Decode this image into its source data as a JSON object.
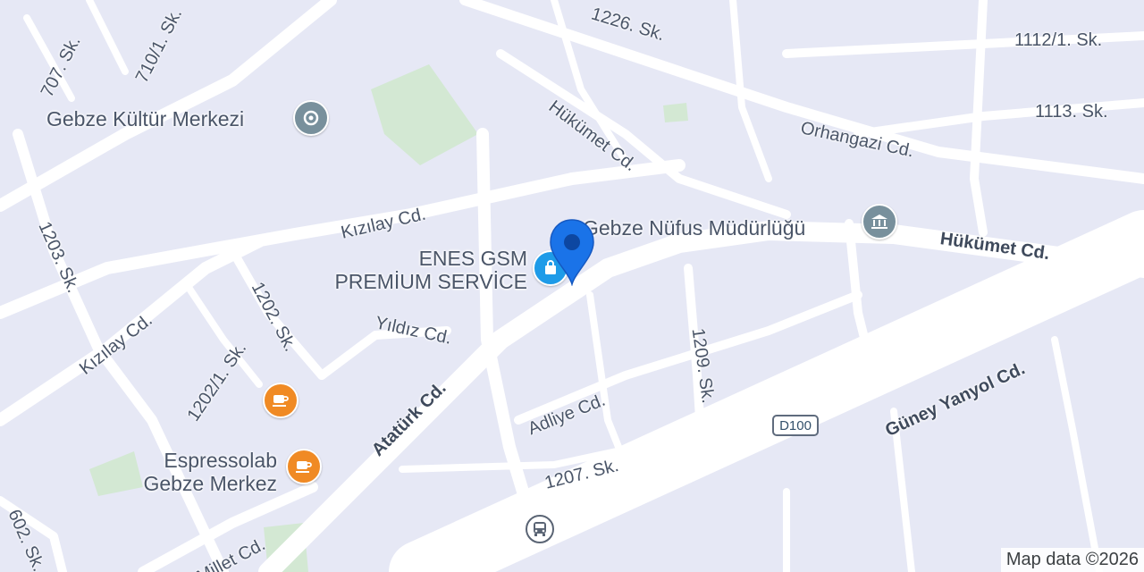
{
  "map": {
    "streets": {
      "s1226": "1226. Sk.",
      "s1112_1": "1112/1. Sk.",
      "s707": "707. Sk.",
      "s710_1": "710/1. Sk.",
      "hukumet_cd_top": "Hükümet Cd.",
      "s1113": "1113. Sk.",
      "orhangazi": "Orhangazi Cd.",
      "kizilay_upper": "Kızılay Cd.",
      "kizilay_lower": "Kızılay Cd.",
      "s1203": "1203. Sk.",
      "s1202": "1202. Sk.",
      "s1202_1": "1202/1. Sk.",
      "yildiz": "Yıldız Cd.",
      "hukumet_cd_right": "Hükümet Cd.",
      "ataturk": "Atatürk Cd.",
      "adliye": "Adliye Cd.",
      "s1209": "1209. Sk.",
      "guney_yanyol": "Güney Yanyol Cd.",
      "s1207": "1207. Sk.",
      "millet": "Millet Cd.",
      "s602": "602. Sk."
    },
    "pois": {
      "kultur": {
        "name": "Gebze Kültür Merkezi",
        "icon": "landmark-icon",
        "color": "#78909c"
      },
      "nufus": {
        "name": "Gebze Nüfus Müdürlüğü",
        "icon": "government-building-icon",
        "color": "#78909c"
      },
      "enes_line1": "ENES GSM",
      "enes_line2": "PREMİUM SERVİCE",
      "enes_icon": "shopping-bag-icon",
      "enes_color": "#1e9be8",
      "espresso_line1": "Espressolab",
      "espresso_line2": "Gebze Merkez",
      "cafe_icon": "coffee-cup-icon",
      "cafe_color": "#f08a24"
    },
    "highway_shield": "D100",
    "selected_pin_color": "#1a73e8",
    "bus_stop_icon": "bus-icon",
    "attribution": "Map data ©2026",
    "colors": {
      "background": "#e6e8f5",
      "road": "#ffffff",
      "park": "#d3e8d3"
    }
  }
}
